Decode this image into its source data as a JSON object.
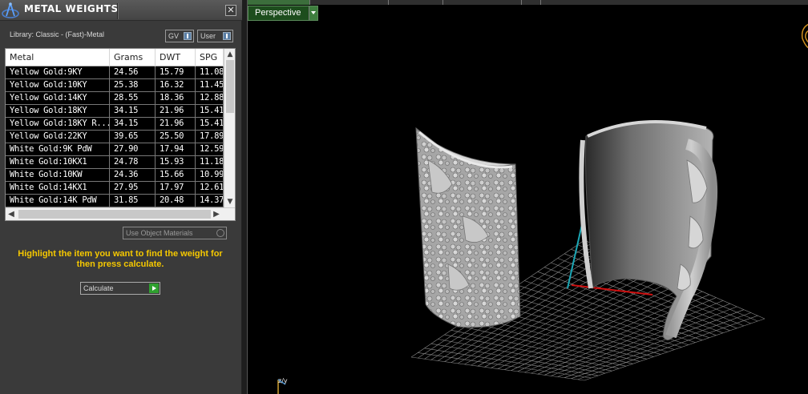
{
  "panel": {
    "title": "METAL WEIGHTS",
    "close_glyph": "✕",
    "library_label": "Library: Classic - (Fast)-Metal",
    "gv_label": "GV",
    "user_label": "User",
    "use_object_materials_label": "Use Object Materials",
    "instruction": "Highlight the item you want to find the weight for then press calculate.",
    "calculate_label": "Calculate"
  },
  "table": {
    "columns": [
      "Metal",
      "Grams",
      "DWT",
      "SPG"
    ],
    "rows": [
      [
        "Yellow Gold:9KY",
        "24.56",
        "15.79",
        "11.08"
      ],
      [
        "Yellow Gold:10KY",
        "25.38",
        "16.32",
        "11.45"
      ],
      [
        "Yellow Gold:14KY",
        "28.55",
        "18.36",
        "12.88"
      ],
      [
        "Yellow Gold:18KY",
        "34.15",
        "21.96",
        "15.41"
      ],
      [
        "Yellow Gold:18KY R...",
        "34.15",
        "21.96",
        "15.41"
      ],
      [
        "Yellow Gold:22KY",
        "39.65",
        "25.50",
        "17.89"
      ],
      [
        "White Gold:9K PdW",
        "27.90",
        "17.94",
        "12.59"
      ],
      [
        "White Gold:10KX1",
        "24.78",
        "15.93",
        "11.18"
      ],
      [
        "White Gold:10KW",
        "24.36",
        "15.66",
        "10.99"
      ],
      [
        "White Gold:14KX1",
        "27.95",
        "17.97",
        "12.61"
      ],
      [
        "White Gold:14K PdW",
        "31.85",
        "20.48",
        "14.37"
      ]
    ]
  },
  "viewport": {
    "view_name": "Perspective",
    "axis_label": "z/y"
  },
  "icons": {
    "app_logo": "compass-logo-icon",
    "close": "close-icon",
    "dropdown": "chevron-down-icon",
    "go": "play-arrow-icon"
  },
  "colors": {
    "instruction_text": "#f5c800",
    "view_button_bg": "#1d4d1d",
    "axis_x": "#d01010",
    "axis_y": "#1aa6b4",
    "grid": "#8a8a8a",
    "model": "#b8b8b8"
  }
}
